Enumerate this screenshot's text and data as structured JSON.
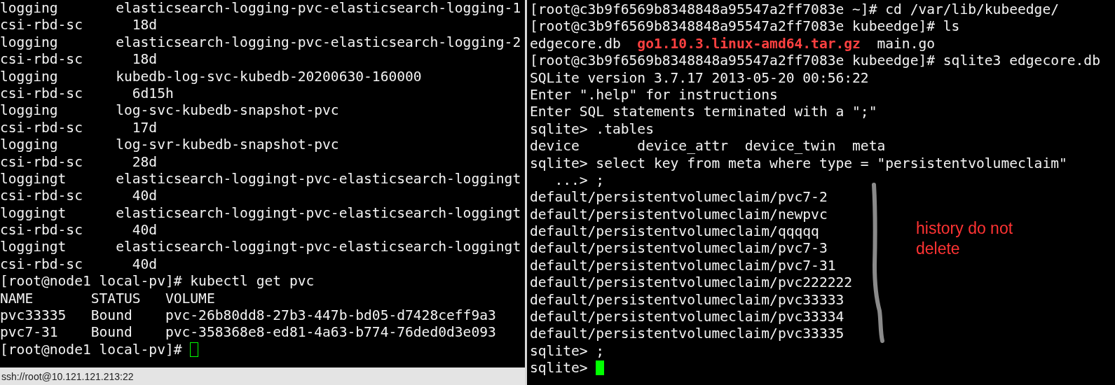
{
  "left_terminal": {
    "focused": false,
    "lines": [
      {
        "kind": "output",
        "text": "logging       elasticsearch-logging-pvc-elasticsearch-logging-1"
      },
      {
        "kind": "output",
        "text": "csi-rbd-sc      18d"
      },
      {
        "kind": "output",
        "text": "logging       elasticsearch-logging-pvc-elasticsearch-logging-2"
      },
      {
        "kind": "output",
        "text": "csi-rbd-sc      18d"
      },
      {
        "kind": "output",
        "text": "logging       kubedb-log-svc-kubedb-20200630-160000"
      },
      {
        "kind": "output",
        "text": "csi-rbd-sc      6d15h"
      },
      {
        "kind": "output",
        "text": "logging       log-svc-kubedb-snapshot-pvc"
      },
      {
        "kind": "output",
        "text": "csi-rbd-sc      17d"
      },
      {
        "kind": "output",
        "text": "logging       log-svr-kubedb-snapshot-pvc"
      },
      {
        "kind": "output",
        "text": "csi-rbd-sc      28d"
      },
      {
        "kind": "output",
        "text": "loggingt      elasticsearch-loggingt-pvc-elasticsearch-loggingt"
      },
      {
        "kind": "output",
        "text": "csi-rbd-sc      40d"
      },
      {
        "kind": "output",
        "text": "loggingt      elasticsearch-loggingt-pvc-elasticsearch-loggingt"
      },
      {
        "kind": "output",
        "text": "csi-rbd-sc      40d"
      },
      {
        "kind": "output",
        "text": "loggingt      elasticsearch-loggingt-pvc-elasticsearch-loggingt"
      },
      {
        "kind": "output",
        "text": "csi-rbd-sc      40d"
      },
      {
        "kind": "output",
        "text": "[root@node1 local-pv]# kubectl get pvc"
      },
      {
        "kind": "output",
        "text": "NAME       STATUS   VOLUME"
      },
      {
        "kind": "output",
        "text": "pvc33335   Bound    pvc-26b80dd8-27b3-447b-bd05-d7428ceff9a3"
      },
      {
        "kind": "output",
        "text": "pvc7-31    Bound    pvc-358368e8-ed81-4a63-b774-76ded0d3e093"
      },
      {
        "kind": "prompt",
        "text": "[root@node1 local-pv]# "
      }
    ]
  },
  "status_bar": {
    "text": "ssh://root@10.121.121.213:22"
  },
  "right_terminal": {
    "focused": true,
    "lines": [
      {
        "kind": "output",
        "text": "[root@c3b9f6569b8348848a95547a2ff7083e ~]# cd /var/lib/kubeedge/"
      },
      {
        "kind": "output",
        "text": "[root@c3b9f6569b8348848a95547a2ff7083e kubeedge]# ls"
      },
      {
        "kind": "listing",
        "segments": [
          {
            "kind": "file",
            "text": "edgecore.db"
          },
          {
            "kind": "archive",
            "text": "go1.10.3.linux-amd64.tar.gz"
          },
          {
            "kind": "file",
            "text": "main.go"
          }
        ]
      },
      {
        "kind": "output",
        "text": "[root@c3b9f6569b8348848a95547a2ff7083e kubeedge]# sqlite3 edgecore.db"
      },
      {
        "kind": "output",
        "text": "SQLite version 3.7.17 2013-05-20 00:56:22"
      },
      {
        "kind": "output",
        "text": "Enter \".help\" for instructions"
      },
      {
        "kind": "output",
        "text": "Enter SQL statements terminated with a \";\""
      },
      {
        "kind": "output",
        "text": "sqlite> .tables"
      },
      {
        "kind": "output",
        "text": "device       device_attr  device_twin  meta"
      },
      {
        "kind": "output",
        "text": "sqlite> select key from meta where type = \"persistentvolumeclaim\""
      },
      {
        "kind": "output",
        "text": "   ...> ;"
      },
      {
        "kind": "output",
        "text": "default/persistentvolumeclaim/pvc7-2"
      },
      {
        "kind": "output",
        "text": "default/persistentvolumeclaim/newpvc"
      },
      {
        "kind": "output",
        "text": "default/persistentvolumeclaim/qqqqq"
      },
      {
        "kind": "output",
        "text": "default/persistentvolumeclaim/pvc7-3"
      },
      {
        "kind": "output",
        "text": "default/persistentvolumeclaim/pvc7-31"
      },
      {
        "kind": "output",
        "text": "default/persistentvolumeclaim/pvc222222"
      },
      {
        "kind": "output",
        "text": "default/persistentvolumeclaim/pvc33333"
      },
      {
        "kind": "output",
        "text": "default/persistentvolumeclaim/pvc33334"
      },
      {
        "kind": "output",
        "text": "default/persistentvolumeclaim/pvc33335"
      },
      {
        "kind": "output",
        "text": "sqlite> ;"
      },
      {
        "kind": "prompt",
        "text": "sqlite> "
      }
    ]
  },
  "annotation": {
    "text": "history do not delete"
  }
}
